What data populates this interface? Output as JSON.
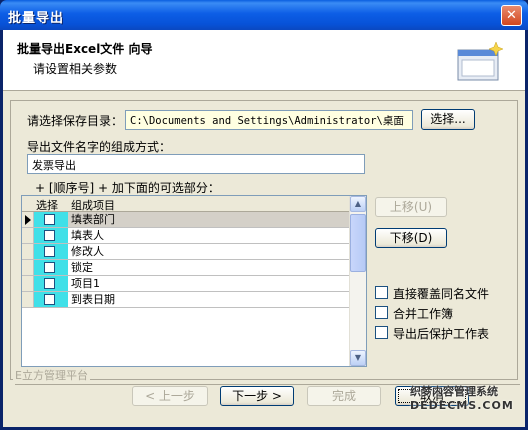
{
  "window": {
    "title": "批量导出",
    "close_glyph": "✕"
  },
  "header": {
    "title": "批量导出Excel文件 向导",
    "subtitle": "请设置相关参数"
  },
  "save_dir": {
    "label": "请选择保存目录：",
    "value": "C:\\Documents and Settings\\Administrator\\桌面",
    "browse_label": "选择..."
  },
  "filename": {
    "label": "导出文件名字的组成方式：",
    "value": "发票导出",
    "hint": "+ [顺序号] + 加下面的可选部分："
  },
  "grid": {
    "columns": [
      "选择",
      "组成项目"
    ],
    "rows": [
      {
        "item": "填表部门",
        "selected": true
      },
      {
        "item": "填表人",
        "selected": false
      },
      {
        "item": "修改人",
        "selected": false
      },
      {
        "item": "锁定",
        "selected": false
      },
      {
        "item": "项目1",
        "selected": false
      },
      {
        "item": "到表日期",
        "selected": false
      }
    ]
  },
  "move_buttons": {
    "up": "上移(U)",
    "down": "下移(D)"
  },
  "options": {
    "overwrite": "直接覆盖同名文件",
    "merge": "合并工作簿",
    "protect": "导出后保护工作表"
  },
  "footer": {
    "group_label": "E立方管理平台",
    "prev": "< 上一步",
    "next": "下一步 >",
    "finish": "完成",
    "cancel": "取消"
  },
  "watermark": {
    "line1": "织梦内容管理系统",
    "line2": "DEDECMS.COM"
  },
  "colors": {
    "titlebar": "#0752d8",
    "checkbox_cell": "#40e0e8",
    "dialog_bg": "#ece9d8"
  }
}
